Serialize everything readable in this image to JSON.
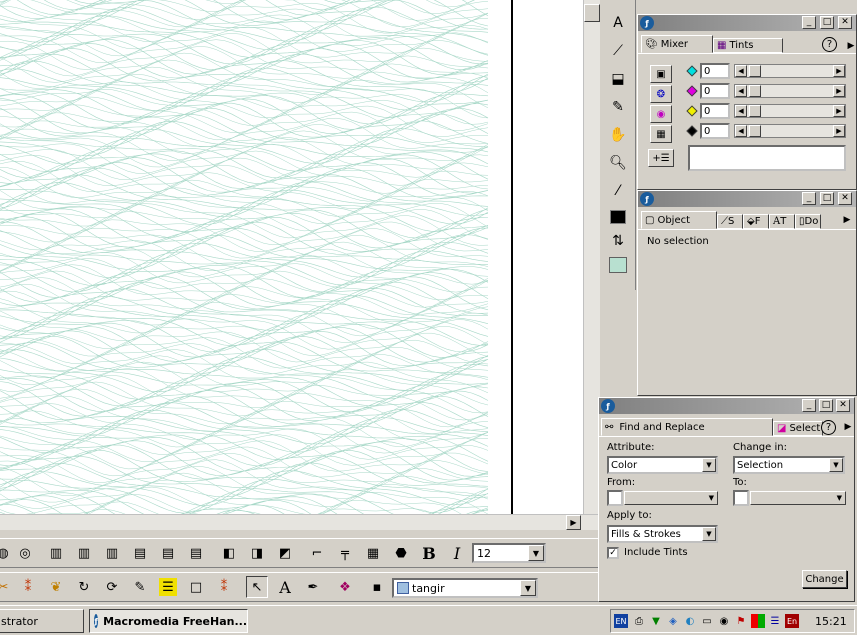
{
  "canvas": {
    "line_color": "#a8d8c8"
  },
  "toolbar_row1": {
    "font_size_value": "12",
    "bold_label": "B",
    "italic_label": "I"
  },
  "toolbar_row2": {
    "text_tool_label": "A",
    "style_combo_value": "tangir"
  },
  "mixer_panel": {
    "tabs": [
      "Mixer",
      "Tints"
    ],
    "help_label": "?",
    "channels": [
      {
        "color": "#00e0e0",
        "value": "0"
      },
      {
        "color": "#e000e0",
        "value": "0"
      },
      {
        "color": "#f0f000",
        "value": "0"
      },
      {
        "color": "#000000",
        "value": "0"
      }
    ]
  },
  "object_panel": {
    "tabs": [
      "Object",
      "S",
      "F",
      "T",
      "Do"
    ],
    "help_label": "?",
    "status": "No selection"
  },
  "find_panel": {
    "tabs": [
      "Find and Replace",
      "Select"
    ],
    "help_label": "?",
    "attribute_label": "Attribute:",
    "attribute_value": "Color",
    "change_in_label": "Change in:",
    "change_in_value": "Selection",
    "from_label": "From:",
    "to_label": "To:",
    "apply_to_label": "Apply to:",
    "apply_to_value": "Fills & Strokes",
    "include_tints_label": "Include Tints",
    "include_tints_checked": true,
    "change_button": "Change"
  },
  "taskbar": {
    "items": [
      "strator",
      "Macromedia FreeHan..."
    ],
    "lang_left": "EN",
    "lang_right": "En",
    "clock": "15:21"
  }
}
